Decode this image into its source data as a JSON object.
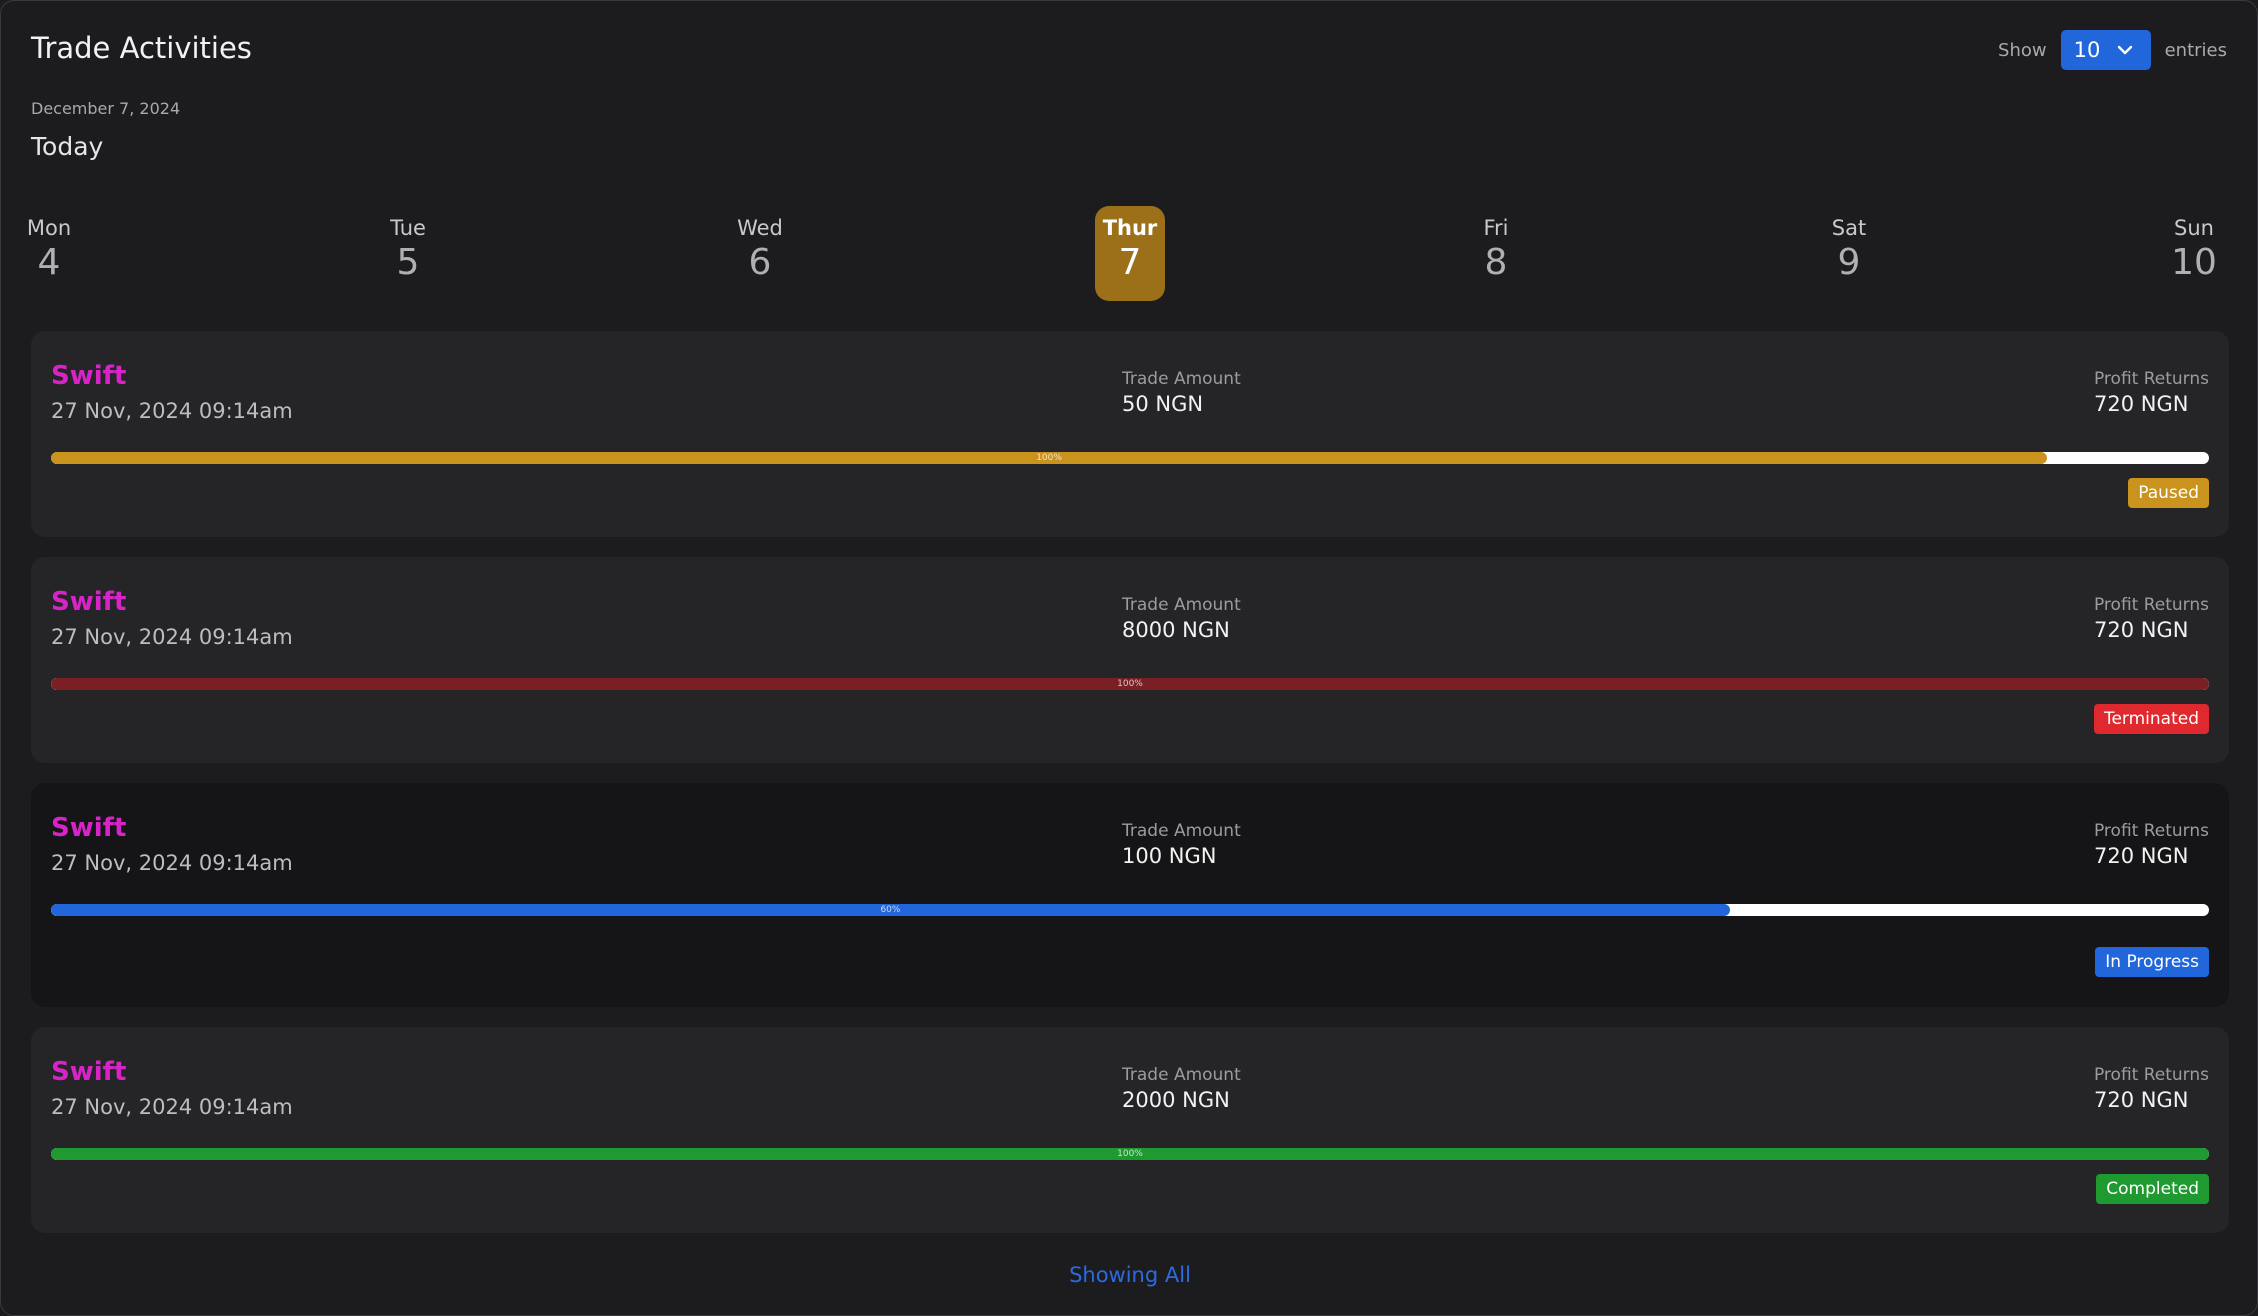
{
  "header": {
    "title": "Trade Activities",
    "show_label": "Show",
    "entries_value": "10",
    "entries_label": "entries",
    "date": "December 7, 2024",
    "today_label": "Today"
  },
  "days": [
    {
      "name": "Mon",
      "num": "4"
    },
    {
      "name": "Tue",
      "num": "5"
    },
    {
      "name": "Wed",
      "num": "6"
    },
    {
      "name": "Thur",
      "num": "7",
      "active": true
    },
    {
      "name": "Fri",
      "num": "8"
    },
    {
      "name": "Sat",
      "num": "9"
    },
    {
      "name": "Sun",
      "num": "10"
    }
  ],
  "trades": [
    {
      "name": "Swift",
      "timestamp": "27 Nov, 2024 09:14am",
      "amount_label": "Trade Amount",
      "amount": "50 NGN",
      "profit_label": "Profit  Returns",
      "profit": "720 NGN",
      "progress_text": "100%",
      "progress": 0.925,
      "status": "Paused",
      "bar_color": "#c9931e",
      "badge_color": "#c9931e"
    },
    {
      "name": "Swift",
      "timestamp": "27 Nov, 2024 09:14am",
      "amount_label": "Trade Amount",
      "amount": "8000 NGN",
      "profit_label": "Profit  Returns",
      "profit": "720 NGN",
      "progress_text": "100%",
      "progress": 1.0,
      "status": "Terminated",
      "bar_color": "#7a1f23",
      "badge_color": "#e0282f"
    },
    {
      "name": "Swift",
      "timestamp": "27 Nov, 2024 09:14am",
      "amount_label": "Trade Amount",
      "amount": "100 NGN",
      "profit_label": "Profit  Returns",
      "profit": "720 NGN",
      "progress_text": "60%",
      "progress": 0.778,
      "status": "In Progress",
      "bar_color": "#2266dc",
      "badge_color": "#2266dc"
    },
    {
      "name": "Swift",
      "timestamp": "27 Nov, 2024 09:14am",
      "amount_label": "Trade Amount",
      "amount": "2000 NGN",
      "profit_label": "Profit  Returns",
      "profit": "720 NGN",
      "progress_text": "100%",
      "progress": 1.0,
      "status": "Completed",
      "bar_color": "#1f9a31",
      "badge_color": "#1f9a31"
    }
  ],
  "footer": {
    "showing_all": "Showing All"
  }
}
